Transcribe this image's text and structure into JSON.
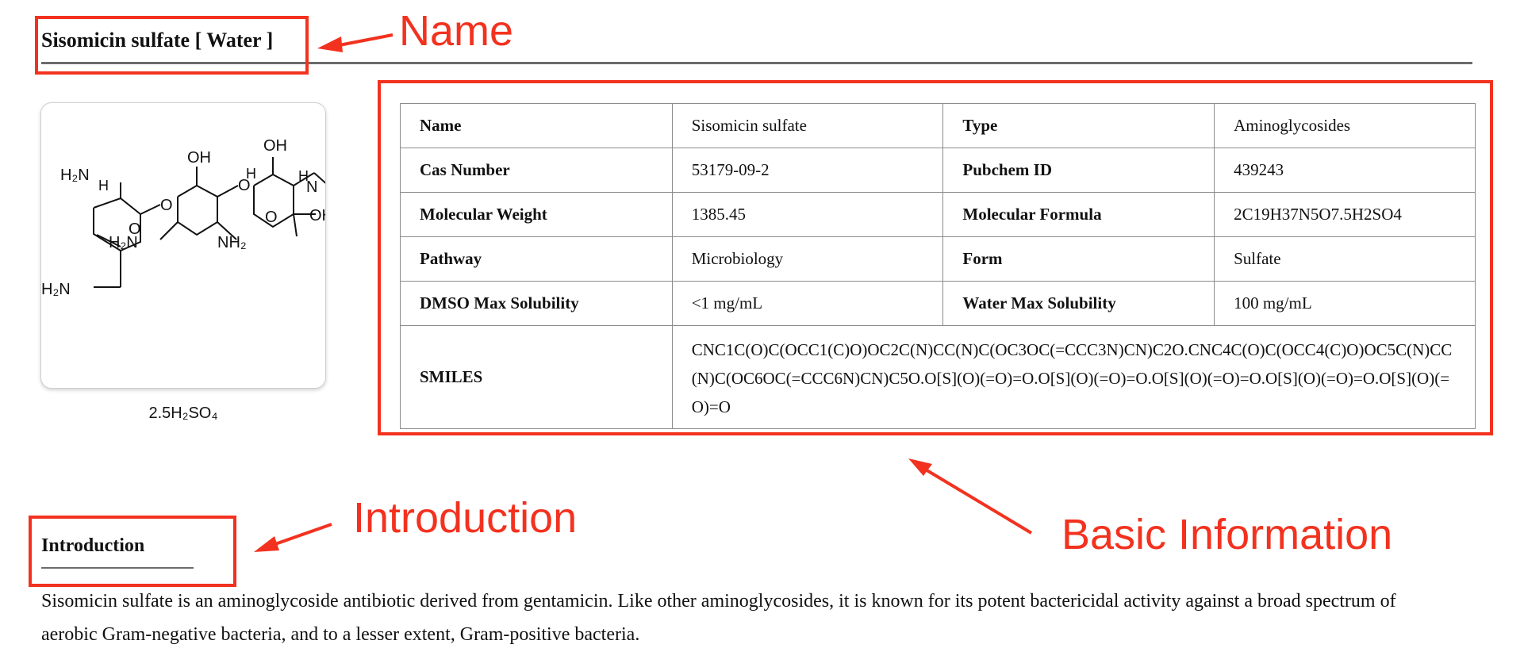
{
  "page": {
    "title": "Sisomicin sulfate [ Water ]"
  },
  "structure": {
    "salt_label": "2.5H₂SO₄",
    "atom_labels": [
      "H₂N",
      "H",
      "O",
      "OH",
      "O",
      "H",
      "OH",
      "H",
      "N",
      "O",
      "OH",
      "O",
      "H₂N",
      "NH₂",
      "H₂N"
    ]
  },
  "info": {
    "rows": [
      {
        "k1": "Name",
        "v1": "Sisomicin sulfate",
        "k2": "Type",
        "v2": "Aminoglycosides"
      },
      {
        "k1": "Cas Number",
        "v1": "53179-09-2",
        "k2": "Pubchem ID",
        "v2": "439243"
      },
      {
        "k1": "Molecular Weight",
        "v1": "1385.45",
        "k2": "Molecular Formula",
        "v2": "2C19H37N5O7.5H2SO4"
      },
      {
        "k1": "Pathway",
        "v1": "Microbiology",
        "k2": "Form",
        "v2": "Sulfate"
      },
      {
        "k1": "DMSO Max Solubility",
        "v1": "<1 mg/mL",
        "k2": "Water Max Solubility",
        "v2": "100 mg/mL"
      }
    ],
    "smiles_label": "SMILES",
    "smiles_value": "CNC1C(O)C(OCC1(C)O)OC2C(N)CC(N)C(OC3OC(=CCC3N)CN)C2O.CNC4C(O)C(OCC4(C)O)OC5C(N)CC(N)C(OC6OC(=CCC6N)CN)C5O.O[S](O)(=O)=O.O[S](O)(=O)=O.O[S](O)(=O)=O.O[S](O)(=O)=O.O[S](O)(=O)=O"
  },
  "intro": {
    "heading": "Introduction",
    "text": "Sisomicin sulfate is an aminoglycoside antibiotic derived from gentamicin. Like other aminoglycosides, it is known for its potent bactericidal activity against a broad spectrum of aerobic Gram-negative bacteria, and to a lesser extent, Gram-positive bacteria."
  },
  "annotations": {
    "name_label": "Name",
    "basic_info_label": "Basic Information",
    "introduction_label": "Introduction",
    "color": "#f2321f"
  }
}
